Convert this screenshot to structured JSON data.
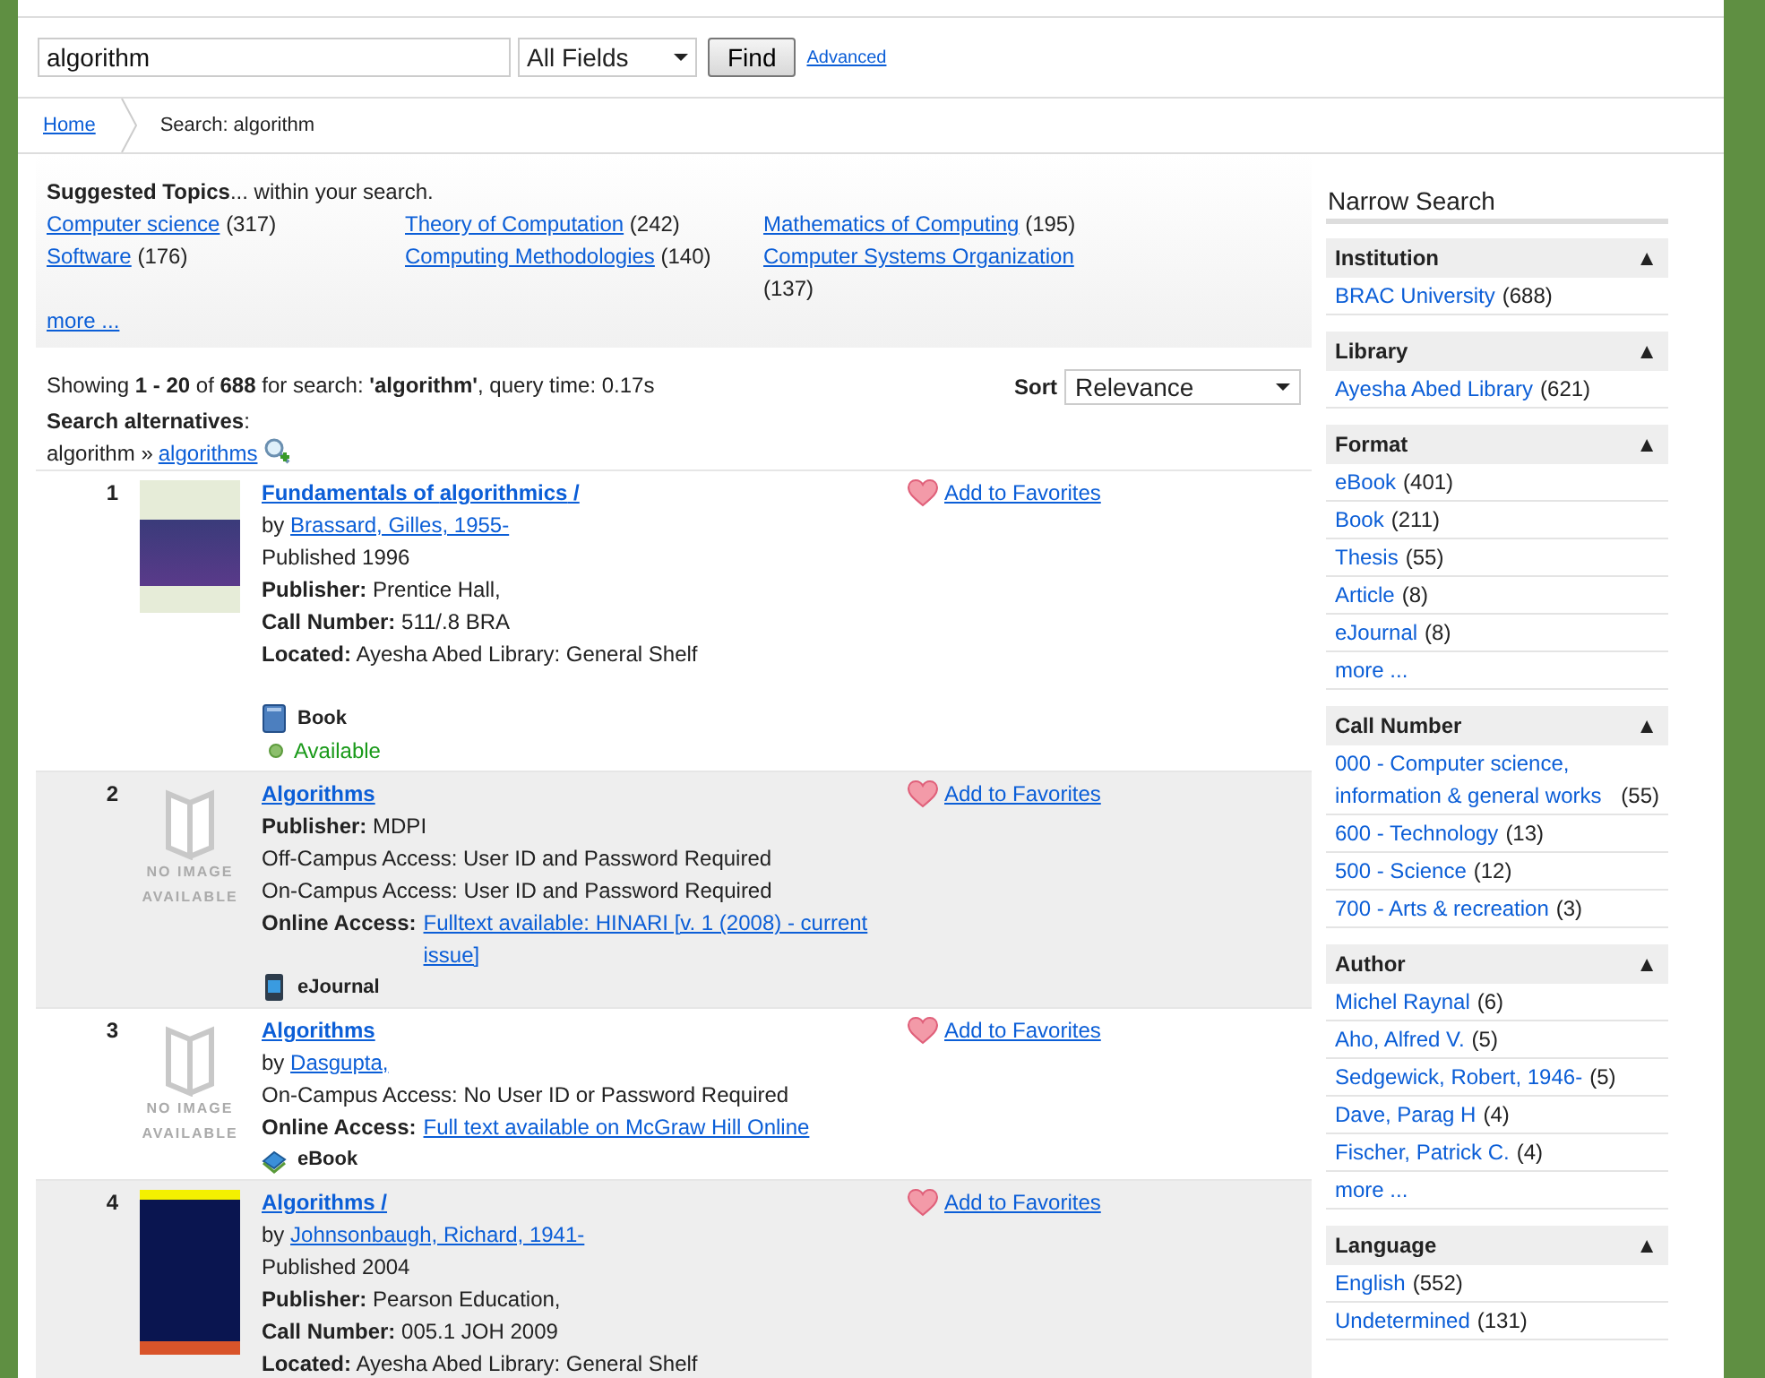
{
  "search": {
    "value": "algorithm",
    "field": "All Fields",
    "button": "Find",
    "advanced": "Advanced"
  },
  "breadcrumb": {
    "home": "Home",
    "current": "Search: algorithm"
  },
  "suggested": {
    "heading": "**Suggested Topics**... within your search.",
    "more": "more ...",
    "topics": [
      {
        "label": "Computer science",
        "count": "(317)"
      },
      {
        "label": "Theory of Computation",
        "count": "(242)"
      },
      {
        "label": "Mathematics of Computing",
        "count": "(195)"
      },
      {
        "label": "Software",
        "count": "(176)"
      },
      {
        "label": "Computing Methodologies",
        "count": "(140)"
      },
      {
        "label": "Computer Systems Organization",
        "count": "(137)"
      }
    ]
  },
  "summary": {
    "text": "Showing **1 - 20** of **688** for search: **'algorithm'**, query time: 0.17s",
    "sort_label": "Sort",
    "sort_value": "Relevance",
    "alternatives": "**Search alternatives**:",
    "original": "algorithm »",
    "suggestion": "algorithms"
  },
  "results": [
    {
      "number": "1",
      "title": "Fundamentals of **algorithmics** /",
      "favorite": "Add to Favorites",
      "lines": [
        {
          "kind": "author",
          "label": "by",
          "value": "Brassard, Gilles, 1955-"
        },
        {
          "kind": "text",
          "text": "Published 1996"
        },
        {
          "kind": "field",
          "label": "Publisher:",
          "value": "Prentice Hall,"
        },
        {
          "kind": "field",
          "label": "Call Number:",
          "value": "511/.8 BRA"
        },
        {
          "kind": "field",
          "label": "Located:",
          "value": "Ayesha Abed Library: General Shelf"
        }
      ],
      "format": {
        "kind": "book",
        "label": "Book"
      },
      "availability": "Available"
    },
    {
      "number": "2",
      "no_image": "NO IMAGE AVAILABLE",
      "title": "Algorithms",
      "favorite": "Add to Favorites",
      "lines": [
        {
          "kind": "field",
          "label": "Publisher:",
          "value": "MDPI"
        },
        {
          "kind": "text",
          "text": "Off-Campus Access: User ID and Password Required"
        },
        {
          "kind": "text",
          "text": "On-Campus Access: User ID and Password Required"
        },
        {
          "kind": "link",
          "label": "Online Access:",
          "value": "Fulltext available: HINARI [v. 1 (2008) - current issue]"
        }
      ],
      "format": {
        "kind": "ejournal",
        "label": "eJournal"
      }
    },
    {
      "number": "3",
      "no_image": "NO IMAGE AVAILABLE",
      "title": "Algorithms",
      "favorite": "Add to Favorites",
      "lines": [
        {
          "kind": "author",
          "label": "by",
          "value": "Dasgupta,"
        },
        {
          "kind": "text",
          "text": "On-Campus Access: No User ID or Password Required"
        },
        {
          "kind": "link",
          "label": "Online Access:",
          "value": "Full text available on McGraw Hill Online"
        }
      ],
      "format": {
        "kind": "ebook",
        "label": "eBook"
      }
    },
    {
      "number": "4",
      "title": "Algorithms /",
      "favorite": "Add to Favorites",
      "lines": [
        {
          "kind": "author",
          "label": "by",
          "value": "Johnsonbaugh, Richard, 1941-"
        },
        {
          "kind": "text",
          "text": "Published 2004"
        },
        {
          "kind": "field",
          "label": "Publisher:",
          "value": "Pearson Education,"
        },
        {
          "kind": "field",
          "label": "Call Number:",
          "value": "005.1 JOH 2009"
        },
        {
          "kind": "field",
          "label": "Located:",
          "value": "Ayesha Abed Library: General Shelf"
        }
      ]
    }
  ],
  "sidebar": {
    "title": "Narrow Search",
    "facets": [
      {
        "title": "Institution",
        "arrow": "▲",
        "items": [
          {
            "label": "BRAC University",
            "count": "(688)"
          }
        ]
      },
      {
        "title": "Library",
        "arrow": "▲",
        "items": [
          {
            "label": "Ayesha Abed Library",
            "count": "(621)"
          }
        ]
      },
      {
        "title": "Format",
        "arrow": "▲",
        "more": "more ...",
        "items": [
          {
            "label": "eBook",
            "count": "(401)"
          },
          {
            "label": "Book",
            "count": "(211)"
          },
          {
            "label": "Thesis",
            "count": "(55)"
          },
          {
            "label": "Article",
            "count": "(8)"
          },
          {
            "label": "eJournal",
            "count": "(8)"
          }
        ]
      },
      {
        "title": "Call Number",
        "arrow": "▲",
        "items": [
          {
            "label": "000 - Computer science, information & general works",
            "count": "(55)"
          },
          {
            "label": "600 - Technology",
            "count": "(13)"
          },
          {
            "label": "500 - Science",
            "count": "(12)"
          },
          {
            "label": "700 - Arts & recreation",
            "count": "(3)"
          }
        ]
      },
      {
        "title": "Author",
        "arrow": "▲",
        "more": "more ...",
        "items": [
          {
            "label": "Michel Raynal",
            "count": "(6)"
          },
          {
            "label": "Aho, Alfred V.",
            "count": "(5)"
          },
          {
            "label": "Sedgewick, Robert, 1946-",
            "count": "(5)"
          },
          {
            "label": "Dave, Parag H",
            "count": "(4)"
          },
          {
            "label": "Fischer, Patrick C.",
            "count": "(4)"
          }
        ]
      },
      {
        "title": "Language",
        "arrow": "▲",
        "items": [
          {
            "label": "English",
            "count": "(552)"
          },
          {
            "label": "Undetermined",
            "count": "(131)"
          }
        ]
      }
    ]
  }
}
